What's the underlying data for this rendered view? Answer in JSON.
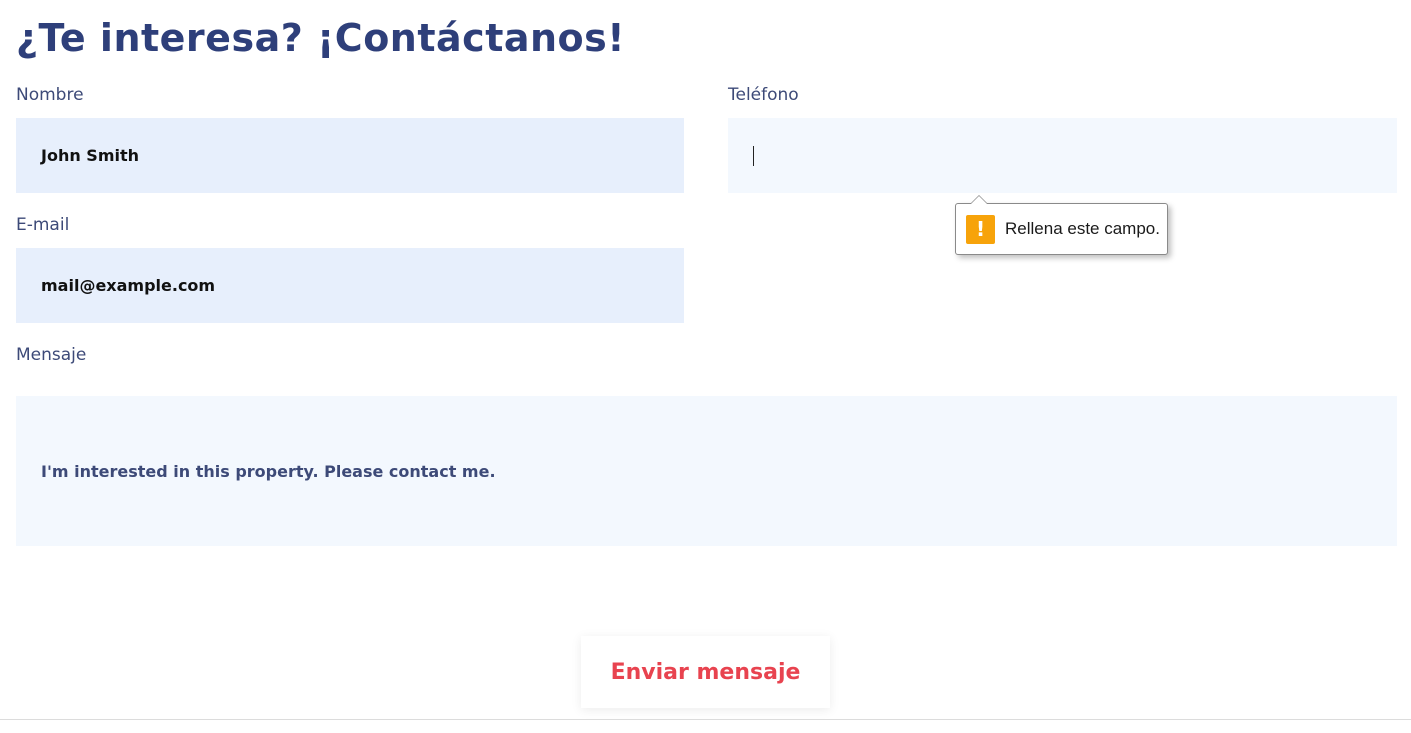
{
  "form": {
    "title": "¿Te interesa? ¡Contáctanos!",
    "name": {
      "label": "Nombre",
      "value": "John Smith"
    },
    "phone": {
      "label": "Teléfono",
      "value": ""
    },
    "email": {
      "label": "E-mail",
      "value": "mail@example.com"
    },
    "message": {
      "label": "Mensaje",
      "value": "I'm interested in this property. Please contact me."
    },
    "submit_label": "Enviar mensaje"
  },
  "validation_tooltip": {
    "icon": "warning-icon",
    "icon_glyph": "!",
    "text": "Rellena este campo."
  },
  "colors": {
    "title": "#2e3f7a",
    "input_filled_bg": "#e7effc",
    "input_empty_bg": "#f3f8fe",
    "submit_text": "#e8434f",
    "warning": "#f7a30a"
  }
}
